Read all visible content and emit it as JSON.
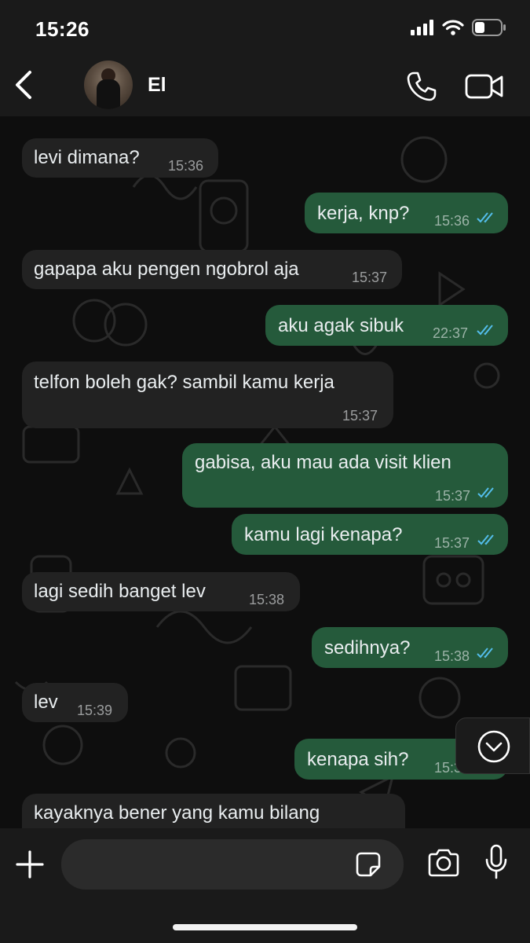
{
  "status_bar": {
    "time": "15:26"
  },
  "header": {
    "contact_name": "El"
  },
  "messages": [
    {
      "dir": "in",
      "text": "levi dimana?",
      "time": "15:36"
    },
    {
      "dir": "out",
      "text": "kerja, knp?",
      "time": "15:36",
      "read": true
    },
    {
      "dir": "in",
      "text": "gapapa aku pengen ngobrol aja",
      "time": "15:37"
    },
    {
      "dir": "out",
      "text": "aku agak sibuk",
      "time": "22:37",
      "read": true
    },
    {
      "dir": "in",
      "text": "telfon boleh gak? sambil kamu kerja",
      "time": "15:37"
    },
    {
      "dir": "out",
      "text": "gabisa, aku mau ada visit klien",
      "time": "15:37",
      "read": true
    },
    {
      "dir": "out",
      "text": "kamu lagi kenapa?",
      "time": "15:37",
      "read": true
    },
    {
      "dir": "in",
      "text": "lagi sedih banget lev",
      "time": "15:38"
    },
    {
      "dir": "out",
      "text": "sedihnya?",
      "time": "15:38",
      "read": true
    },
    {
      "dir": "in",
      "text": "lev",
      "time": "15:39"
    },
    {
      "dir": "out",
      "text": "kenapa sih?",
      "time": "15:3",
      "read": true
    },
    {
      "dir": "in",
      "text": "kayaknya bener yang kamu bilang"
    }
  ],
  "colors": {
    "incoming_bubble": "#222222",
    "outgoing_bubble": "#255a3b",
    "read_ticks": "#53bdeb",
    "bar_background": "#1a1a1a"
  },
  "icons": {
    "back": "chevron-left-icon",
    "call": "phone-icon",
    "video": "video-camera-icon",
    "scroll": "chevron-down-circle-icon",
    "attach": "plus-icon",
    "sticker": "sticker-icon",
    "camera": "camera-icon",
    "mic": "microphone-icon"
  }
}
